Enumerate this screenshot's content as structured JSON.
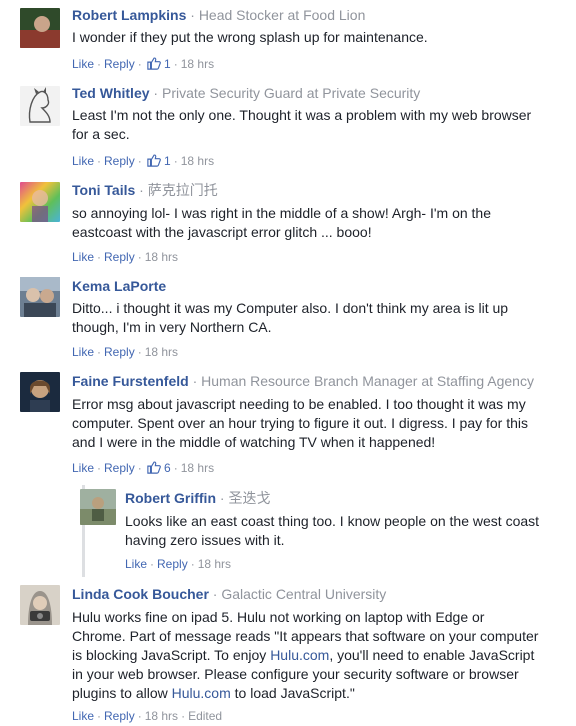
{
  "comments": [
    {
      "author": "Robert Lampkins",
      "affiliation": "Head Stocker at Food Lion",
      "text": "I wonder if they put the wrong splash up for maintenance.",
      "like": "Like",
      "reply": "Reply",
      "likes": "1",
      "time": "18 hrs",
      "avatar_colors": [
        "#8b3a2e",
        "#c9a48a"
      ]
    },
    {
      "author": "Ted Whitley",
      "affiliation": "Private Security Guard at Private Security",
      "text": "Least I'm not the only one. Thought it was a problem with my web browser for a sec.",
      "like": "Like",
      "reply": "Reply",
      "likes": "1",
      "time": "18 hrs",
      "avatar_colors": [
        "#f2f2f2",
        "#555555"
      ]
    },
    {
      "author": "Toni Tails",
      "affiliation": "萨克拉门托",
      "text": "so annoying lol- I was right in the middle of a show! Argh- I'm on the eastcoast with the javascript error glitch ... booo!",
      "like": "Like",
      "reply": "Reply",
      "time": "18 hrs",
      "avatar_colors": [
        "#e04b8f",
        "#4ab3d8"
      ]
    },
    {
      "author": "Kema LaPorte",
      "text": "Ditto... i thought it was my Computer also. I don't think my area is lit up though, I'm in very Northern CA.",
      "like": "Like",
      "reply": "Reply",
      "time": "18 hrs",
      "avatar_colors": [
        "#6d7f92",
        "#d9c1ab"
      ]
    },
    {
      "author": "Faine Furstenfeld",
      "affiliation": "Human Resource Branch Manager at Staffing Agency",
      "text": "Error msg about javascript needing to be enabled. I too thought it was my computer. Spent over an hour trying to figure it out. I digress. I pay for this and I were in the middle of watching TV when it happened!",
      "like": "Like",
      "reply": "Reply",
      "likes": "6",
      "time": "18 hrs",
      "avatar_colors": [
        "#1b2a3e",
        "#c7a27f"
      ]
    },
    {
      "author": "Robert Griffin",
      "affiliation": "圣迭戈",
      "text": "Looks like an east coast thing too. I know people on the west coast having zero issues with it.",
      "like": "Like",
      "reply": "Reply",
      "time": "18 hrs",
      "avatar_colors": [
        "#7c8b6a",
        "#b9a07e"
      ]
    },
    {
      "author": "Linda Cook Boucher",
      "affiliation": "Galactic Central University",
      "text_before": "Hulu works fine on ipad 5. Hulu not working on laptop with Edge or Chrome. Part of message reads \"It appears that software on your computer is blocking JavaScript. To enjoy ",
      "link1": "Hulu.com",
      "text_middle": ", you'll need to enable JavaScript in your web browser. Please configure your security software or browser plugins to allow ",
      "link2": "Hulu.com",
      "text_after": " to load JavaScript.\"",
      "like": "Like",
      "reply": "Reply",
      "time": "18 hrs",
      "edited": "Edited",
      "avatar_colors": [
        "#9a948c",
        "#d8d2c8"
      ]
    }
  ],
  "colors": {
    "link": "#365899",
    "action": "#4267b2",
    "meta": "#90949c",
    "text": "#1d2129"
  }
}
